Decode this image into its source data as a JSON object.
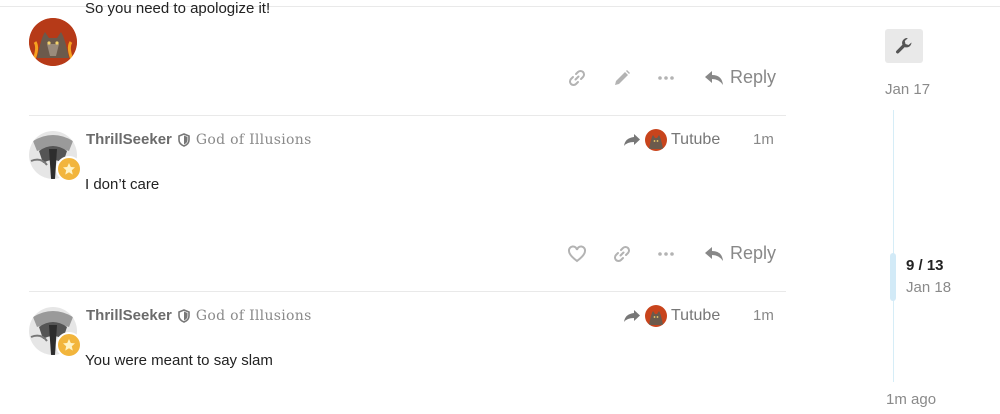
{
  "posts": [
    {
      "text": "So you need to apologize it!",
      "actions": {
        "reply_label": "Reply"
      }
    },
    {
      "username": "ThrillSeeker",
      "user_title": "God of Illusions",
      "reply_to_user": "Tutube",
      "time": "1m",
      "text": "I don’t care",
      "actions": {
        "reply_label": "Reply"
      }
    },
    {
      "username": "ThrillSeeker",
      "user_title": "God of Illusions",
      "reply_to_user": "Tutube",
      "time": "1m",
      "text": "You were meant to say slam"
    }
  ],
  "timeline": {
    "start_date": "Jan 17",
    "position": "9 / 13",
    "position_date": "Jan 18",
    "end_label": "1m ago"
  },
  "colors": {
    "muted": "#888888",
    "badge": "#f2b53c",
    "rail": "#d6edf7"
  }
}
